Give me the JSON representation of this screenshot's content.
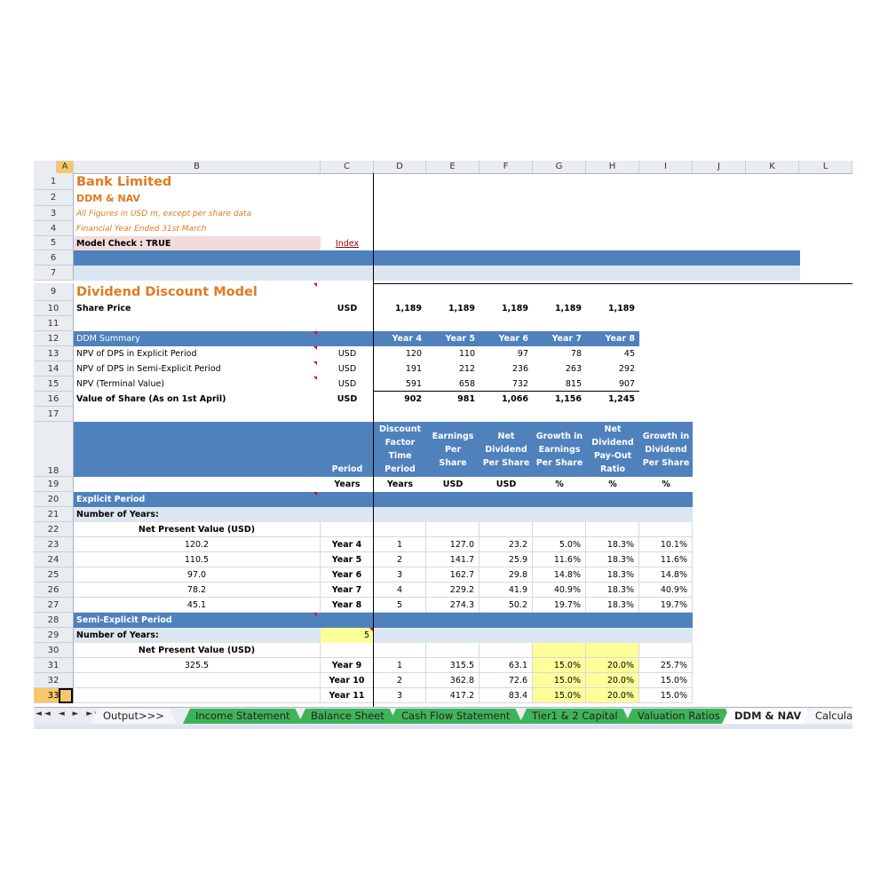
{
  "columns": [
    "A",
    "B",
    "C",
    "D",
    "E",
    "F",
    "G",
    "H",
    "I",
    "J",
    "K",
    "L"
  ],
  "sheet": {
    "company": "Bank Limited",
    "section": "DDM & NAV",
    "note1": "All Figures in USD m, except per share data",
    "note2": "Financial Year Ended 31st March",
    "model_check": "Model Check : TRUE",
    "index_link": "Index",
    "ddm_title": "Dividend Discount Model",
    "share_price_label": "Share Price",
    "share_price_unit": "USD",
    "share_price_values": [
      "1,189",
      "1,189",
      "1,189",
      "1,189",
      "1,189"
    ],
    "ddm_summary_label": "DDM Summary",
    "years_header": [
      "Year 4",
      "Year 5",
      "Year 6",
      "Year 7",
      "Year 8"
    ],
    "summary_rows": [
      {
        "label": "NPV of DPS in Explicit Period",
        "unit": "USD",
        "values": [
          "120",
          "110",
          "97",
          "78",
          "45"
        ]
      },
      {
        "label": "NPV of DPS in Semi-Explicit Period",
        "unit": "USD",
        "values": [
          "191",
          "212",
          "236",
          "263",
          "292"
        ]
      },
      {
        "label": "NPV (Terminal Value)",
        "unit": "USD",
        "values": [
          "591",
          "658",
          "732",
          "815",
          "907"
        ]
      }
    ],
    "value_share": {
      "label": "Value of Share (As on 1st April)",
      "unit": "USD",
      "values": [
        "902",
        "981",
        "1,066",
        "1,156",
        "1,245"
      ]
    },
    "table_headers": {
      "period": "Period",
      "discount": "Discount Factor Time Period",
      "earnings": "Earnings Per Share",
      "netdiv": "Net Dividend Per Share",
      "growth_earn": "Growth in Earnings Per Share",
      "payout": "Net Dividend Pay-Out Ratio",
      "growth_div": "Growth in Dividend Per Share"
    },
    "units_row": [
      "Years",
      "Years",
      "USD",
      "USD",
      "%",
      "%",
      "%"
    ],
    "explicit_label": "Explicit Period",
    "num_years_label": "Number of Years:",
    "npv_label": "Net Present Value (USD)",
    "explicit_rows": [
      {
        "npv": "120.2",
        "year": "Year 4",
        "t": "1",
        "eps": "127.0",
        "dps": "23.2",
        "ge": "5.0%",
        "po": "18.3%",
        "gd": "10.1%"
      },
      {
        "npv": "110.5",
        "year": "Year 5",
        "t": "2",
        "eps": "141.7",
        "dps": "25.9",
        "ge": "11.6%",
        "po": "18.3%",
        "gd": "11.6%"
      },
      {
        "npv": "97.0",
        "year": "Year 6",
        "t": "3",
        "eps": "162.7",
        "dps": "29.8",
        "ge": "14.8%",
        "po": "18.3%",
        "gd": "14.8%"
      },
      {
        "npv": "78.2",
        "year": "Year 7",
        "t": "4",
        "eps": "229.2",
        "dps": "41.9",
        "ge": "40.9%",
        "po": "18.3%",
        "gd": "40.9%"
      },
      {
        "npv": "45.1",
        "year": "Year 8",
        "t": "5",
        "eps": "274.3",
        "dps": "50.2",
        "ge": "19.7%",
        "po": "18.3%",
        "gd": "19.7%"
      }
    ],
    "semi_label": "Semi-Explicit Period",
    "semi_num_years": "5",
    "semi_rows": [
      {
        "npv": "325.5",
        "year": "Year 9",
        "t": "1",
        "eps": "315.5",
        "dps": "63.1",
        "ge": "15.0%",
        "po": "20.0%",
        "gd": "25.7%"
      },
      {
        "npv": "",
        "year": "Year 10",
        "t": "2",
        "eps": "362.8",
        "dps": "72.6",
        "ge": "15.0%",
        "po": "20.0%",
        "gd": "15.0%"
      },
      {
        "npv": "",
        "year": "Year 11",
        "t": "3",
        "eps": "417.2",
        "dps": "83.4",
        "ge": "15.0%",
        "po": "20.0%",
        "gd": "15.0%"
      }
    ]
  },
  "tabs": [
    "Output>>>",
    "Income Statement",
    "Balance Sheet",
    "Cash Flow Statement",
    "Tier1 & 2 Capital",
    "Valuation Ratios",
    "DDM & NAV",
    "Calcula"
  ],
  "tab_nav": "◄◄ ◄ ► ►►",
  "colors": {
    "blue": "#4f81bd",
    "light": "#dce6f1",
    "orange": "#e07a1f",
    "yellow": "#ffff99",
    "tab_green": "#3fb35a"
  }
}
